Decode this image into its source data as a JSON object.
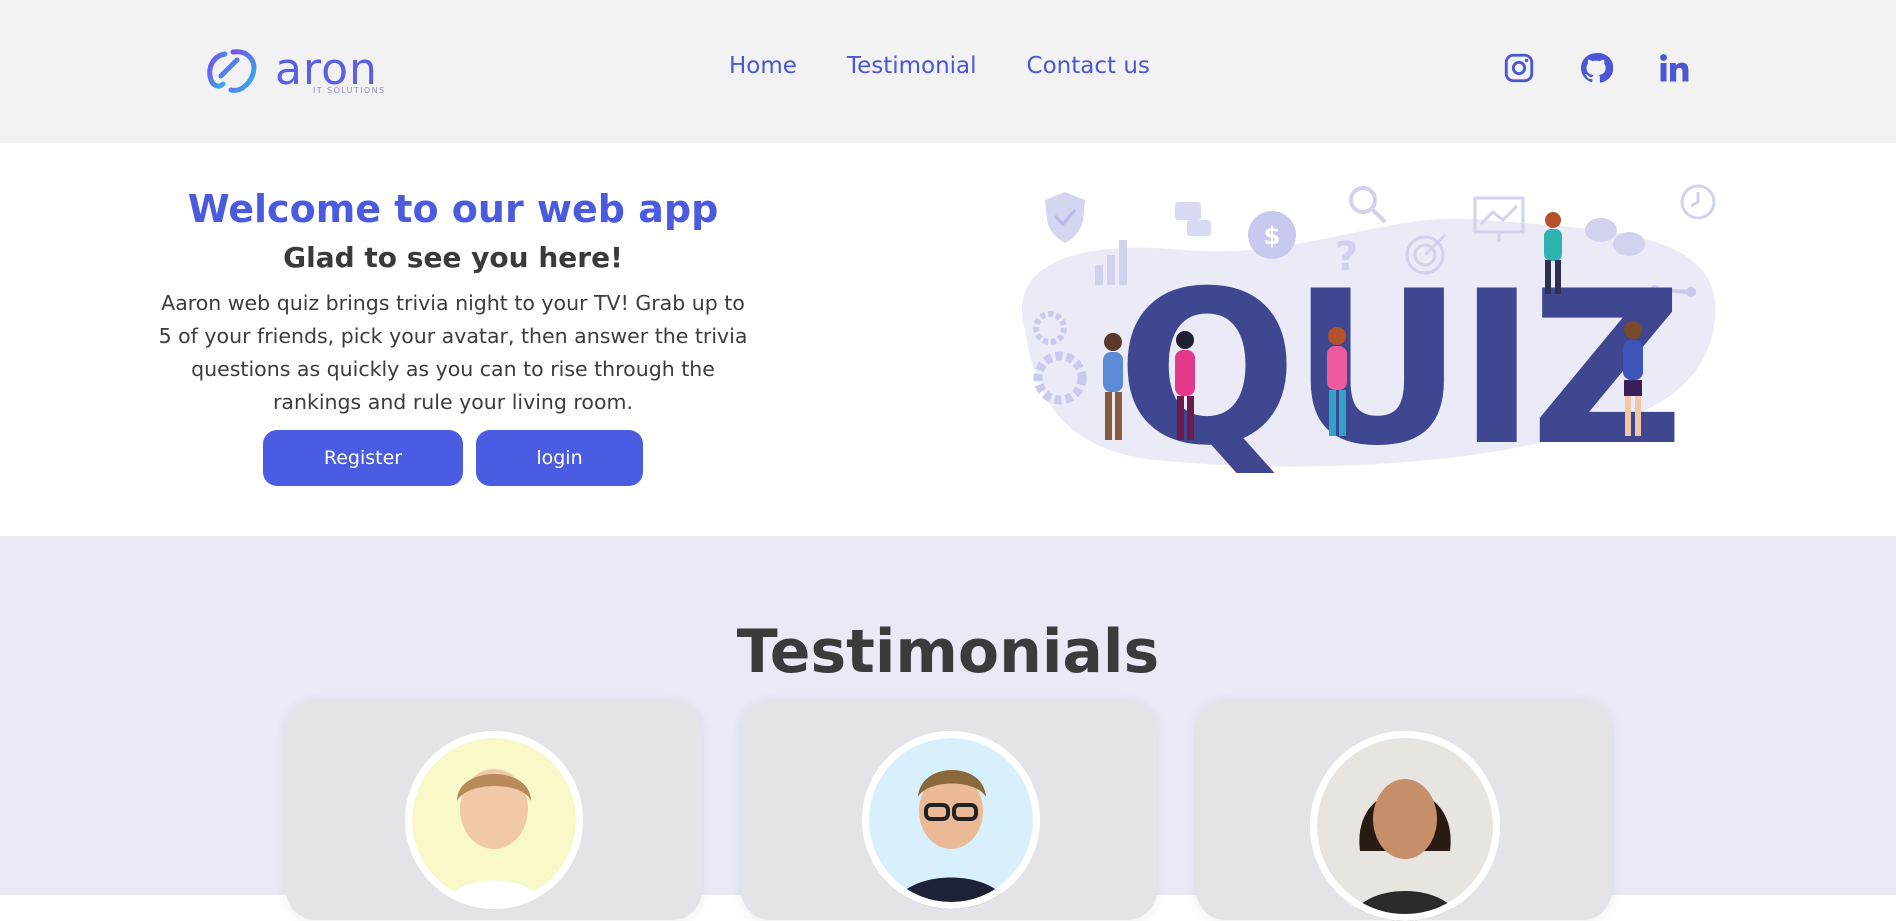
{
  "header": {
    "logo_text": "aron",
    "logo_sub": "IT SOLUTIONS",
    "nav": [
      {
        "label": "Home"
      },
      {
        "label": "Testimonial"
      },
      {
        "label": "Contact us"
      }
    ],
    "social": [
      "instagram-icon",
      "github-icon",
      "linkedin-icon"
    ]
  },
  "hero": {
    "title": "Welcome to our web app",
    "subtitle": "Glad to see you here!",
    "description": "Aaron web quiz brings trivia night to your TV! Grab up to 5 of your friends, pick your avatar, then answer the trivia questions as quickly as you can to rise through the rankings and rule your living room.",
    "register_label": "Register",
    "login_label": "login",
    "art_text": "QUIZ"
  },
  "testimonials": {
    "title": "Testimonials"
  },
  "colors": {
    "accent": "#4a5de2",
    "header_bg": "#f2f2f2",
    "testimonials_bg": "#e9eaf6",
    "quiz_letters": "#3f4790"
  }
}
